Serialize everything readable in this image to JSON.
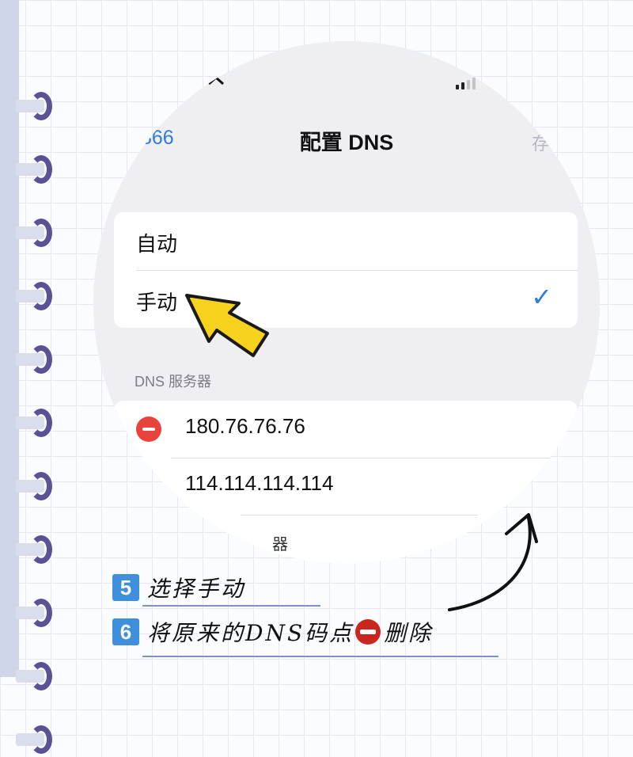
{
  "status_bar": {
    "signal_icon": "wifi-icon"
  },
  "nav": {
    "back": "866",
    "title": "配置 DNS",
    "save": "存"
  },
  "options": [
    {
      "label": "自动",
      "selected": false
    },
    {
      "label": "手动",
      "selected": true
    }
  ],
  "dns": {
    "section_header": "DNS 服务器",
    "servers": [
      "180.76.76.76",
      "114.114.114.114"
    ],
    "partial_label": "器"
  },
  "annotations": {
    "step5_num": "5",
    "step5_text": "选择手动",
    "step6_num": "6",
    "step6_text_a": "将原来的DNS码点",
    "step6_text_b": "删除"
  },
  "colors": {
    "accent": "#2f7bd8",
    "delete": "#e9443b",
    "badge": "#3f8fdc",
    "arrow": "#f6d21e"
  }
}
